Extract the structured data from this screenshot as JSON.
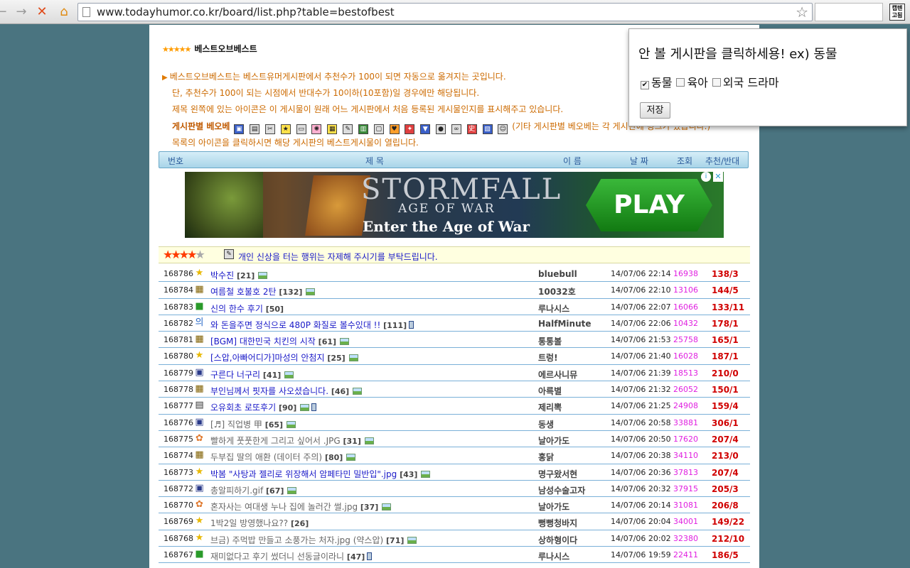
{
  "browser": {
    "url": "www.todayhumor.co.kr/board/list.php?table=bestofbest",
    "back_glyph": "←",
    "forward_glyph": "→",
    "stop_glyph": "✕",
    "home_glyph": "⌂",
    "bookmark_glyph": "☆",
    "extension_label": "캡텐 고됨"
  },
  "page": {
    "stars": "★★★★★",
    "title": "베스트오브베스트",
    "desc1": "베스트오브베스트는 베스트유머게시판에서 추천수가 100이 되면 자동으로 옮겨지는 곳입니다.",
    "desc2": "단, 추천수가 100이 되는 시점에서 반대수가 10이하(10포함)일 경우에만 해당됩니다.",
    "desc3": "제목 왼쪽에 있는 아이콘은 이 게시물이 원래 어느 게시판에서 처음 등록된 게시물인지를 표시해주고 있습니다.",
    "board_icons_label": "게시판별 베오베",
    "board_icons_note": "(기타 게시판별 베오베는 각 게시판에 링크가 있습니다.)",
    "desc5": "목록의 아이콘을 클릭하시면 해당 게시판의 베스트게시물이 열립니다."
  },
  "list_header": {
    "num": "번호",
    "title": "제 목",
    "name": "이 름",
    "date": "날 짜",
    "views": "조회",
    "rec": "추천/반대"
  },
  "ad": {
    "title": "STORMFALL",
    "subtitle": "AGE OF WAR",
    "tagline": "Enter the Age of War",
    "play": "PLAY",
    "info": "i",
    "close": "✕"
  },
  "notice": {
    "stars_full": "★★★★",
    "stars_empty": "★",
    "text": "개인 신상을 터는 행위는 자제해 주시기를 부탁드립니다."
  },
  "rows": [
    {
      "num": "168786",
      "icon": "★",
      "icon_color": "#e8b800",
      "title": "박수진",
      "count": "[21]",
      "img": true,
      "mob": false,
      "gray": false,
      "name": "bluebull",
      "date": "14/07/06 22:14",
      "views": "16938",
      "rec": "138/3"
    },
    {
      "num": "168784",
      "icon": "▦",
      "icon_color": "#806000",
      "title": "여름철 호불호 2탄",
      "count": "[132]",
      "img": true,
      "mob": false,
      "gray": false,
      "name": "10032호",
      "date": "14/07/06 22:10",
      "views": "13106",
      "rec": "144/5"
    },
    {
      "num": "168783",
      "icon": "■",
      "icon_color": "#2a9a2a",
      "title": "신의 한수 후기",
      "count": "[50]",
      "img": false,
      "mob": false,
      "gray": false,
      "name": "루나시스",
      "date": "14/07/06 22:07",
      "views": "16066",
      "rec": "133/11"
    },
    {
      "num": "168782",
      "icon": "의",
      "icon_color": "#2a6ac8",
      "title": "와 돈을주면 정식으로 480P 화질로 볼수있대 !!",
      "count": "[111]",
      "img": false,
      "mob": true,
      "gray": false,
      "name": "HalfMinute",
      "date": "14/07/06 22:06",
      "views": "10432",
      "rec": "178/1"
    },
    {
      "num": "168781",
      "icon": "▦",
      "icon_color": "#806000",
      "title": "[BGM] 대한민국 치킨의 시작",
      "count": "[61]",
      "img": true,
      "mob": false,
      "gray": false,
      "name": "통통볼",
      "date": "14/07/06 21:53",
      "views": "25758",
      "rec": "165/1"
    },
    {
      "num": "168780",
      "icon": "★",
      "icon_color": "#e8b800",
      "title": "[스압,아빠어디가]마성의 안첨지",
      "count": "[25]",
      "img": true,
      "mob": false,
      "gray": false,
      "name": "트렁!",
      "date": "14/07/06 21:40",
      "views": "16028",
      "rec": "187/1"
    },
    {
      "num": "168779",
      "icon": "▣",
      "icon_color": "#2a3a8a",
      "title": "구른다 너구리",
      "count": "[41]",
      "img": true,
      "mob": false,
      "gray": false,
      "name": "에르사니뮤",
      "date": "14/07/06 21:39",
      "views": "18513",
      "rec": "210/0"
    },
    {
      "num": "168778",
      "icon": "▦",
      "icon_color": "#806000",
      "title": "부인님께서 핏자를 사오셨습니다.",
      "count": "[46]",
      "img": true,
      "mob": false,
      "gray": false,
      "name": "아륵별",
      "date": "14/07/06 21:32",
      "views": "26052",
      "rec": "150/1"
    },
    {
      "num": "168777",
      "icon": "▤",
      "icon_color": "#333333",
      "title": "오유회초 로또후기",
      "count": "[90]",
      "img": true,
      "mob": true,
      "gray": false,
      "name": "제리뽁",
      "date": "14/07/06 21:25",
      "views": "24908",
      "rec": "159/4"
    },
    {
      "num": "168776",
      "icon": "▣",
      "icon_color": "#2a3a8a",
      "title": "[♬] 직업병 甲",
      "count": "[65]",
      "img": true,
      "mob": false,
      "gray": true,
      "name": "동생",
      "date": "14/07/06 20:58",
      "views": "33881",
      "rec": "306/1"
    },
    {
      "num": "168775",
      "icon": "✿",
      "icon_color": "#e07a30",
      "title": "빨하게 풋풋한게 그리고 싶어서 .JPG",
      "count": "[31]",
      "img": true,
      "mob": false,
      "gray": true,
      "name": "날아가도",
      "date": "14/07/06 20:50",
      "views": "17620",
      "rec": "207/4"
    },
    {
      "num": "168774",
      "icon": "▦",
      "icon_color": "#806000",
      "title": "두부집 딸의 애환 (데이터 주의)",
      "count": "[80]",
      "img": true,
      "mob": false,
      "gray": true,
      "name": "홍닭",
      "date": "14/07/06 20:38",
      "views": "34110",
      "rec": "213/0"
    },
    {
      "num": "168773",
      "icon": "★",
      "icon_color": "#e8b800",
      "title": "박봄 \"사탕과 젤리로 위장해서 암페타민 밀반입\".jpg",
      "count": "[43]",
      "img": true,
      "mob": false,
      "gray": false,
      "name": "명구왔서현",
      "date": "14/07/06 20:36",
      "views": "37813",
      "rec": "207/4"
    },
    {
      "num": "168772",
      "icon": "▣",
      "icon_color": "#2a3a8a",
      "title": "총알피하기.gif",
      "count": "[67]",
      "img": true,
      "mob": false,
      "gray": true,
      "name": "남성수술고자",
      "date": "14/07/06 20:32",
      "views": "37915",
      "rec": "205/3"
    },
    {
      "num": "168770",
      "icon": "✿",
      "icon_color": "#e07a30",
      "title": "혼자사는 여대생 누나 집에 놀러간 썰.jpg",
      "count": "[37]",
      "img": true,
      "mob": false,
      "gray": true,
      "name": "날아가도",
      "date": "14/07/06 20:14",
      "views": "31081",
      "rec": "206/8"
    },
    {
      "num": "168769",
      "icon": "★",
      "icon_color": "#e8b800",
      "title": "1박2일 방영했나요??",
      "count": "[26]",
      "img": false,
      "mob": false,
      "gray": true,
      "name": "뻥뻥청바지",
      "date": "14/07/06 20:04",
      "views": "34001",
      "rec": "149/22"
    },
    {
      "num": "168768",
      "icon": "★",
      "icon_color": "#e8b800",
      "title": "브금) 주먹밥 만들고 소풍가는 처자.jpg (약스압)",
      "count": "[71]",
      "img": true,
      "mob": false,
      "gray": true,
      "name": "상하형이다",
      "date": "14/07/06 20:02",
      "views": "32380",
      "rec": "212/10"
    },
    {
      "num": "168767",
      "icon": "■",
      "icon_color": "#2a9a2a",
      "title": "재미없다고 후기 썼더니 선동글이라니",
      "count": "[47]",
      "img": false,
      "mob": true,
      "gray": true,
      "name": "루나시스",
      "date": "14/07/06 19:59",
      "views": "22411",
      "rec": "186/5"
    }
  ],
  "popup": {
    "title": "안 볼 게시판을 클릭하세용! ex) 동물",
    "options": [
      {
        "label": "동물",
        "checked": true
      },
      {
        "label": "육아",
        "checked": false
      },
      {
        "label": "외국 드라마",
        "checked": false
      }
    ],
    "save": "저장"
  }
}
